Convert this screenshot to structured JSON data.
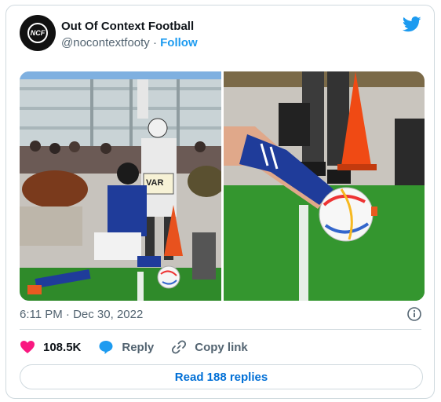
{
  "account": {
    "avatar_text": "NCF",
    "display_name": "Out Of Context Football",
    "handle": "@nocontextfooty",
    "separator": "·",
    "follow_label": "Follow"
  },
  "media": {
    "photo_1_sign_text": "VAR"
  },
  "meta": {
    "timestamp": "6:11 PM · Dec 30, 2022"
  },
  "actions": {
    "like_count": "108.5K",
    "reply_label": "Reply",
    "copy_link_label": "Copy link"
  },
  "footer": {
    "read_replies_label": "Read 188 replies"
  },
  "colors": {
    "accent": "#1d9bf0",
    "like": "#f91880",
    "link_text": "#006fd6"
  },
  "icons": {
    "brand": "twitter-bird-icon",
    "info": "info-icon",
    "like": "heart-icon",
    "reply": "speech-bubble-icon",
    "copy": "link-icon"
  }
}
